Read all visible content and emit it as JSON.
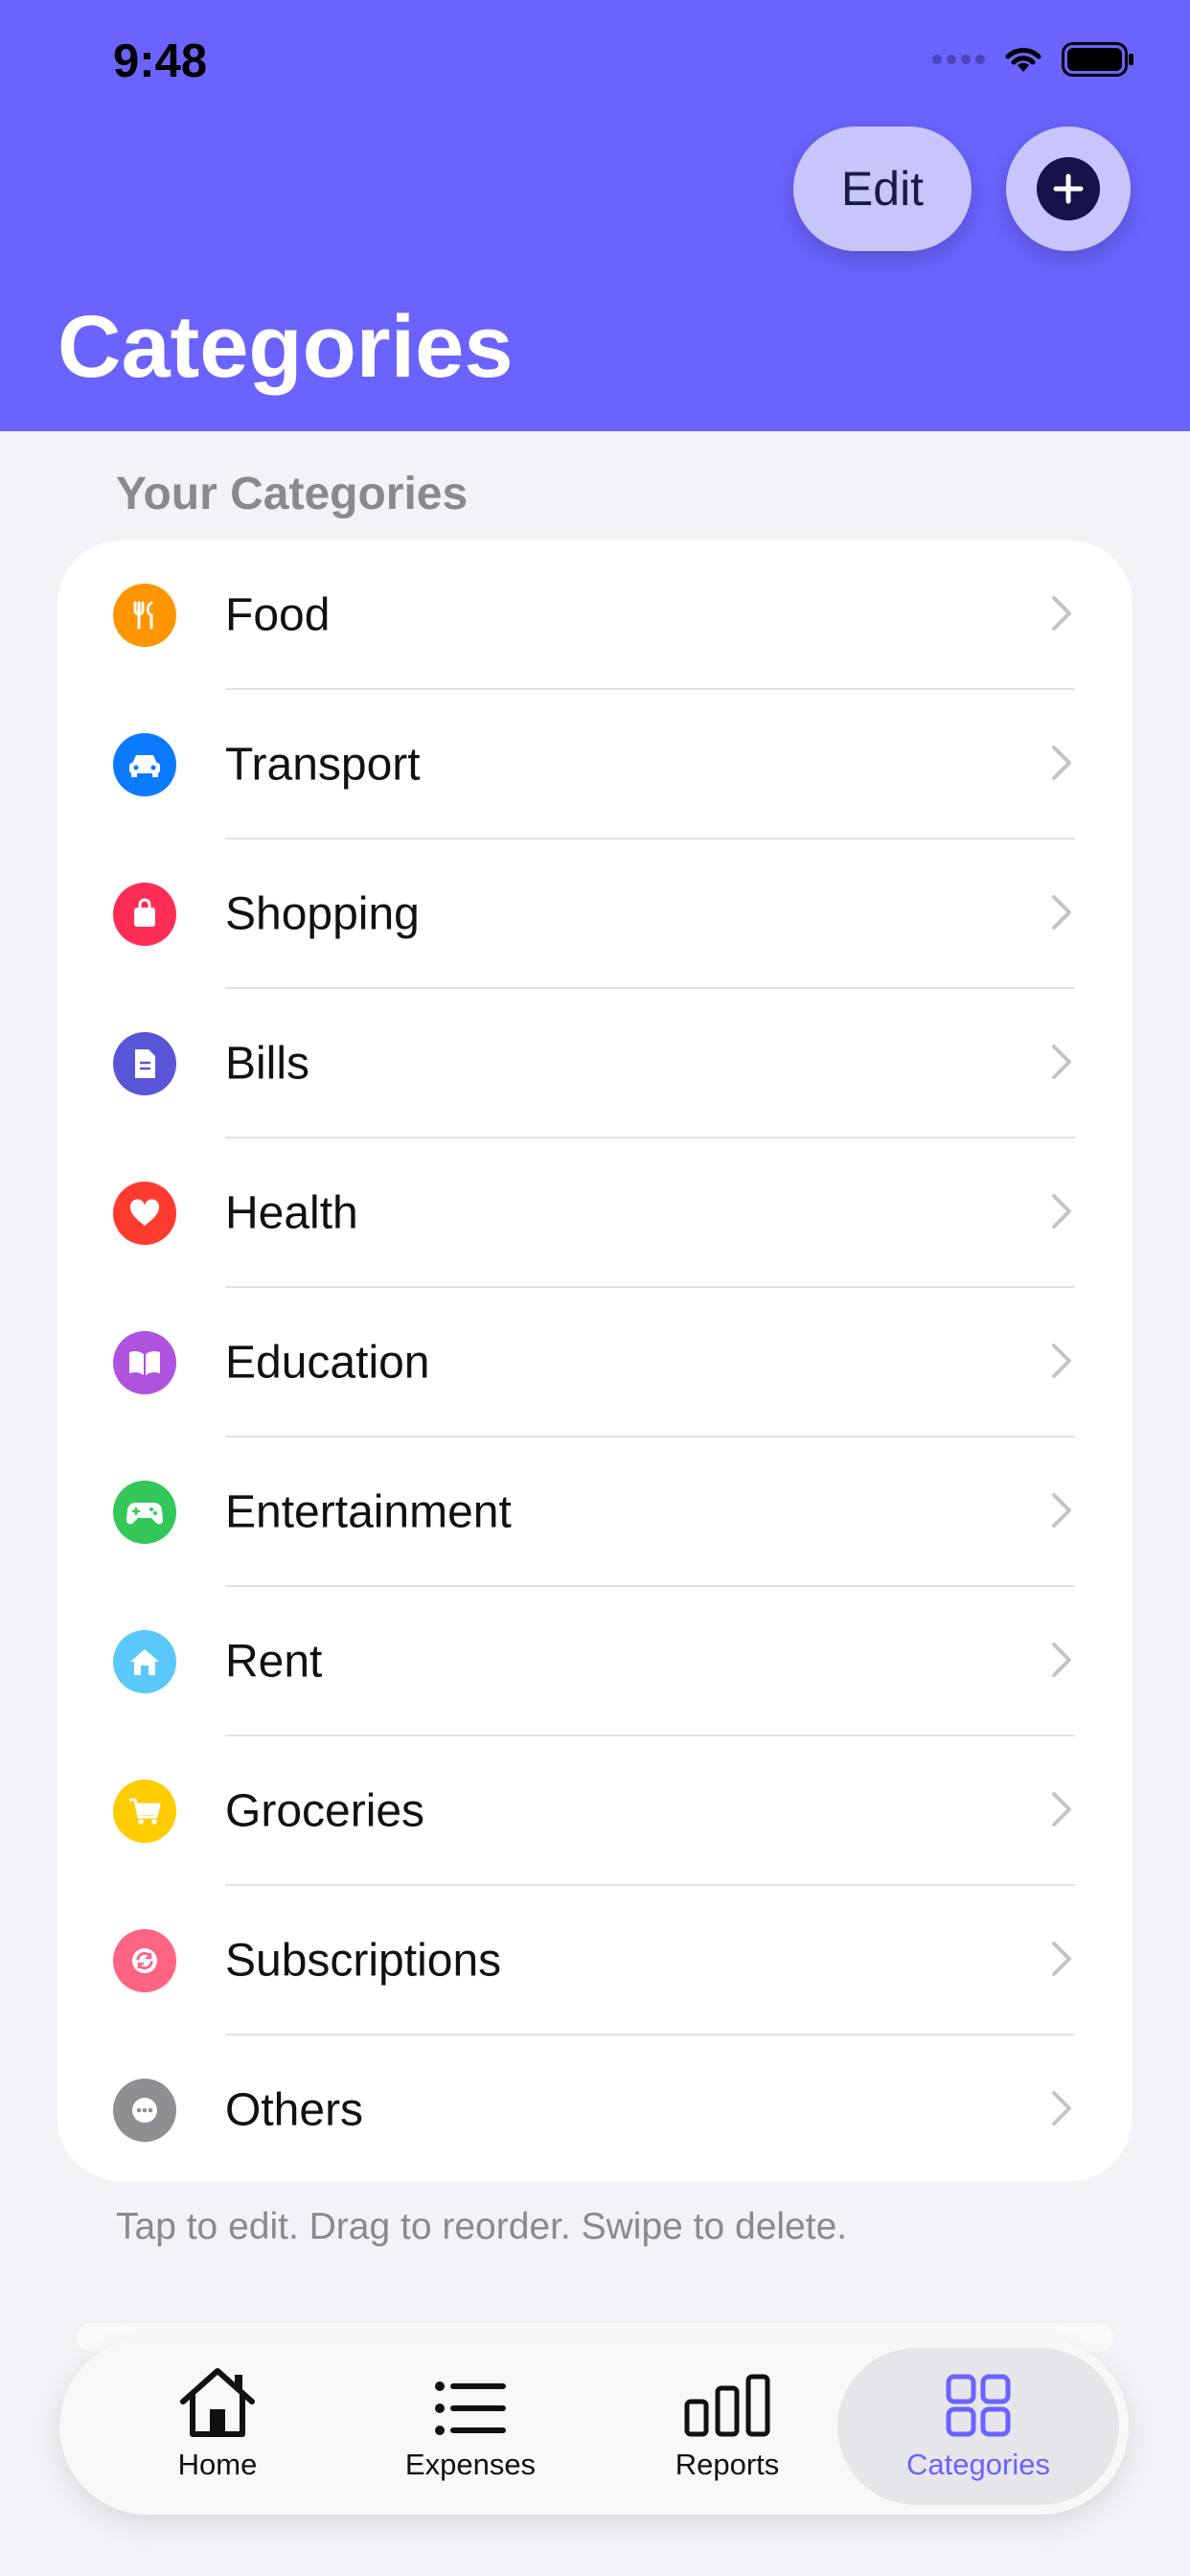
{
  "status_bar": {
    "time": "9:48"
  },
  "header": {
    "title": "Categories",
    "edit_label": "Edit",
    "add_icon": "plus-circle-icon",
    "background": "#6a63fe"
  },
  "section": {
    "label": "Your Categories"
  },
  "categories": [
    {
      "label": "Food",
      "icon": "fork-knife-icon",
      "color": "#ff9500"
    },
    {
      "label": "Transport",
      "icon": "car-icon",
      "color": "#0a7aff"
    },
    {
      "label": "Shopping",
      "icon": "shopping-bag-icon",
      "color": "#ff2d55"
    },
    {
      "label": "Bills",
      "icon": "document-icon",
      "color": "#5856d6"
    },
    {
      "label": "Health",
      "icon": "heart-icon",
      "color": "#ff3b30"
    },
    {
      "label": "Education",
      "icon": "book-icon",
      "color": "#af52de"
    },
    {
      "label": "Entertainment",
      "icon": "gamepad-icon",
      "color": "#34c759"
    },
    {
      "label": "Rent",
      "icon": "house-icon",
      "color": "#5ac8fa"
    },
    {
      "label": "Groceries",
      "icon": "cart-icon",
      "color": "#ffcc00"
    },
    {
      "label": "Subscriptions",
      "icon": "refresh-icon",
      "color": "#ff6482"
    },
    {
      "label": "Others",
      "icon": "ellipsis-icon",
      "color": "#8e8e93"
    }
  ],
  "footer": {
    "hint": "Tap to edit. Drag to reorder. Swipe to delete."
  },
  "tabbar": {
    "tabs": [
      {
        "label": "Home",
        "icon": "house-icon"
      },
      {
        "label": "Expenses",
        "icon": "list-icon"
      },
      {
        "label": "Reports",
        "icon": "bar-chart-icon"
      },
      {
        "label": "Categories",
        "icon": "grid-icon",
        "active": true
      }
    ],
    "active_color": "#6a63fe"
  }
}
